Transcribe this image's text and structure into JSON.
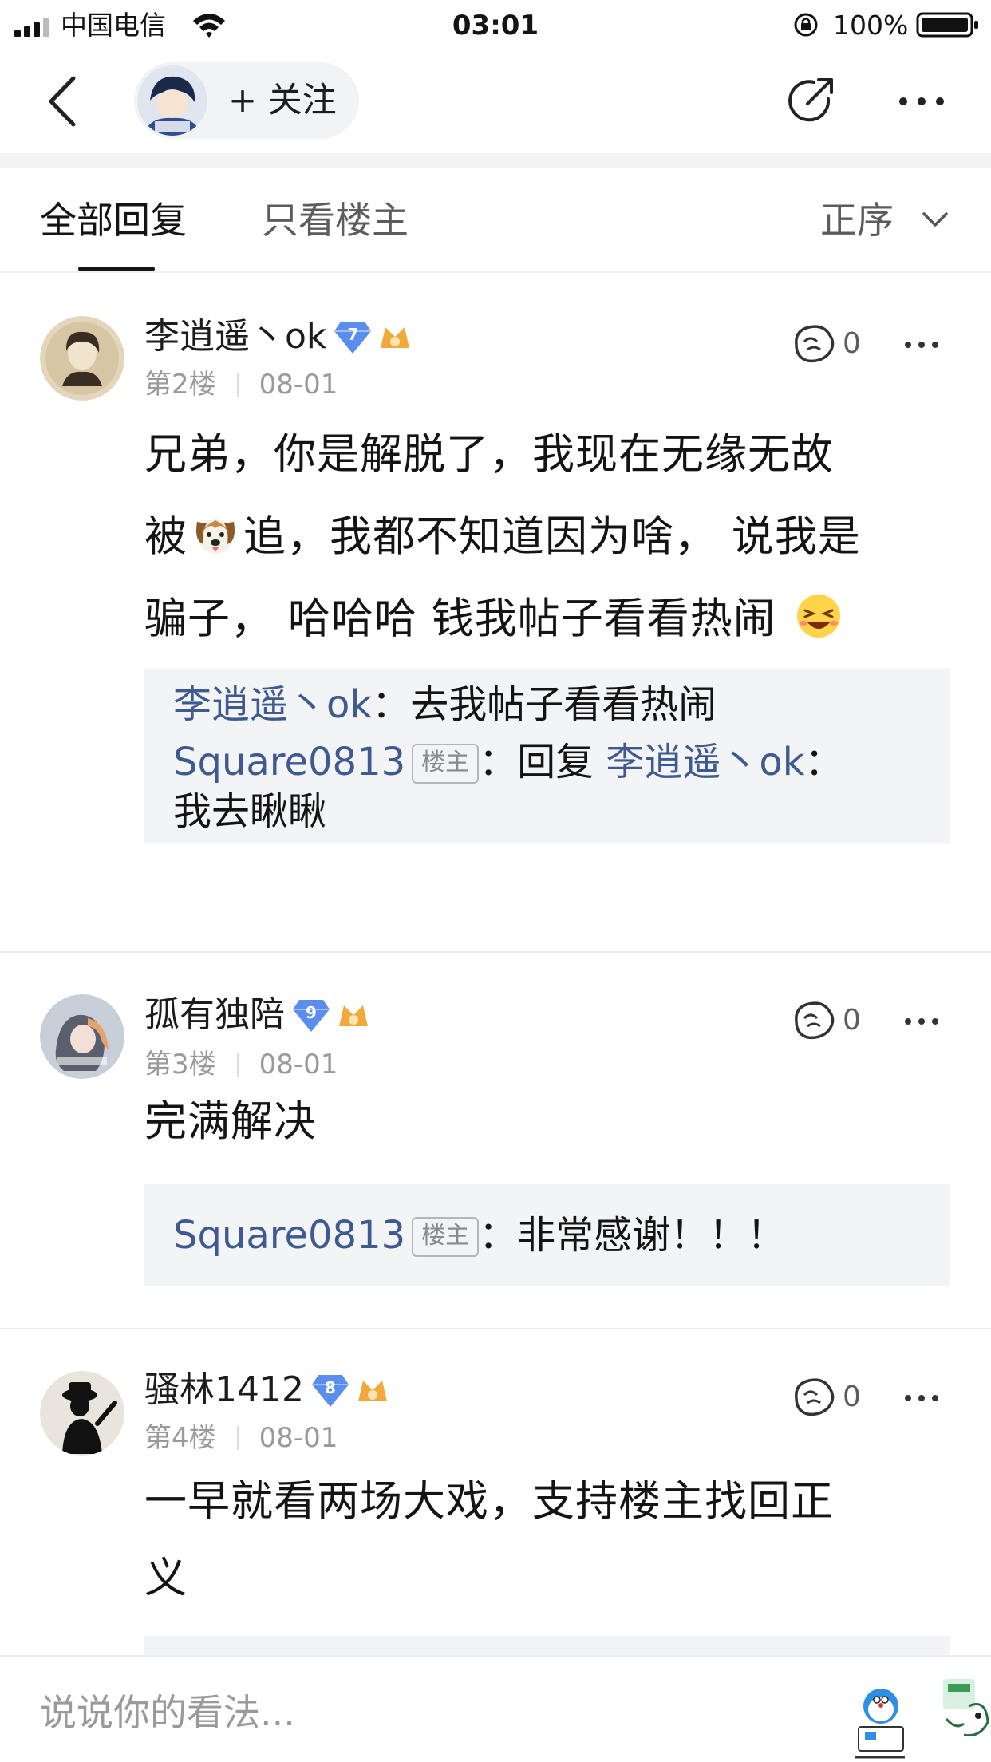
{
  "status_bar": {
    "carrier": "中国电信",
    "time": "03:01",
    "battery": "100%"
  },
  "nav": {
    "follow_label": "+ 关注",
    "icons": [
      "back-icon",
      "share-icon",
      "more-icon"
    ]
  },
  "tabs": {
    "all": "全部回复",
    "owner_only": "只看楼主",
    "sort": "正序"
  },
  "posts": [
    {
      "username": "李逍遥丶ok",
      "level": "7",
      "floor": "第2楼",
      "date": "08-01",
      "likes": "0",
      "content_lines": [
        "兄弟，你是解脱了，我现在无缘无故",
        [
          "被",
          "追，我都不知道因为啥， 说我是"
        ],
        "骗子， 哈哈哈 钱我帖子看看热闹"
      ],
      "replies": [
        {
          "name": "李逍遥丶ok",
          "sep": "：",
          "text": "去我帖子看看热闹"
        },
        {
          "name": "Square0813",
          "tag": "楼主",
          "sep": "：",
          "pre": "回复 ",
          "target": "李逍遥丶ok",
          "text": "：",
          "text2": "我去瞅瞅"
        }
      ]
    },
    {
      "username": "孤有独陪",
      "level": "9",
      "floor": "第3楼",
      "date": "08-01",
      "likes": "0",
      "content": "完满解决",
      "replies": [
        {
          "name": "Square0813",
          "tag": "楼主",
          "sep": "：",
          "text": "非常感谢！！！"
        }
      ]
    },
    {
      "username": "骚林1412",
      "level": "8",
      "floor": "第4楼",
      "date": "08-01",
      "likes": "0",
      "content_lines": [
        "一早就看两场大戏，支持楼主找回正",
        "义"
      ]
    }
  ],
  "bottom": {
    "placeholder": "说说你的看法..."
  },
  "colors": {
    "link": "#3e5a91",
    "badge": "#5b8def",
    "fan_badge": "#f0a93a",
    "reply_bg": "#f3f4f6"
  }
}
